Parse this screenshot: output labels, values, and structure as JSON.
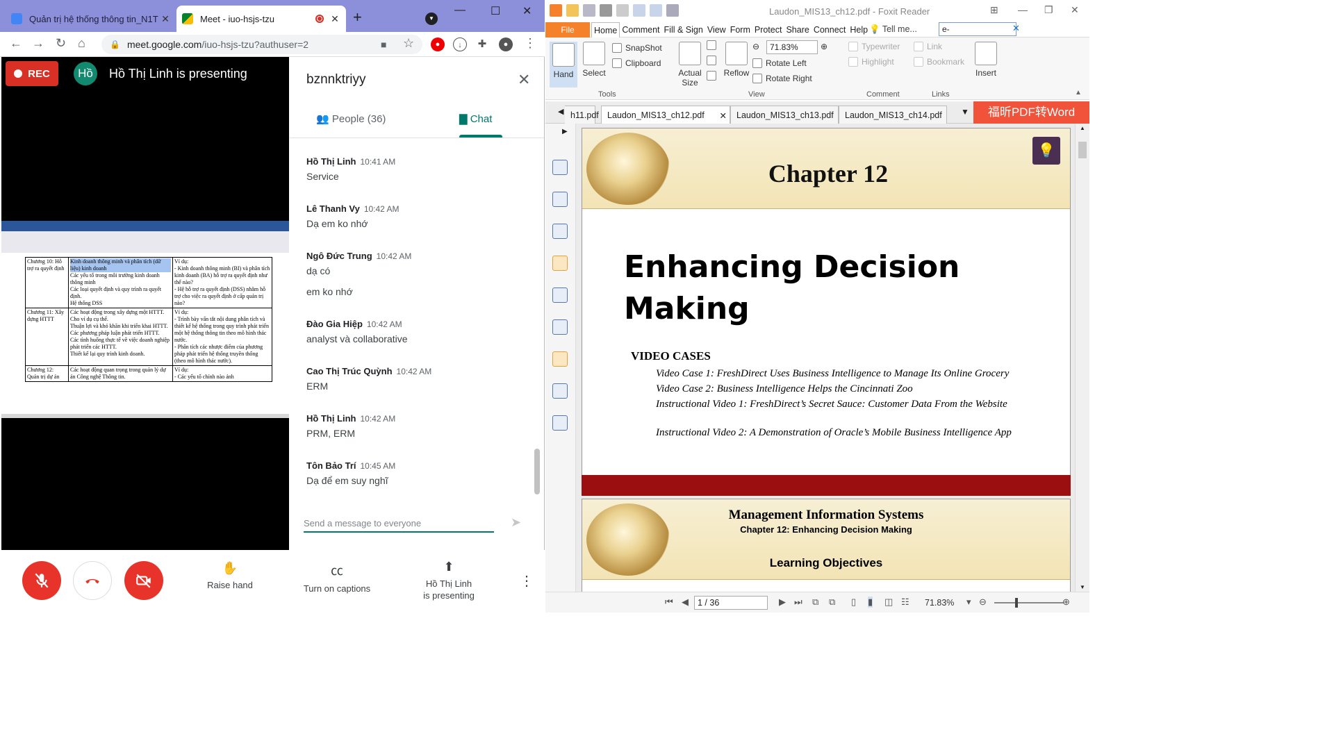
{
  "chrome": {
    "tabs": [
      {
        "title": "Quản trị hệ thống thông tin_N1T",
        "color": "#4285f4",
        "active": false
      },
      {
        "title": "Meet - iuo-hsjs-tzu",
        "color": "#00832d",
        "active": true
      }
    ],
    "url_host": "meet.google.com",
    "url_path": "/iuo-hsjs-tzu?authuser=2"
  },
  "meet": {
    "rec_label": "REC",
    "presenter_initials": "Hồ",
    "presenting_title": "Hồ Thị Linh is presenting",
    "meeting_code": "bznnktriyy",
    "people_tab": "People (36)",
    "chat_tab": "Chat",
    "composer_placeholder": "Send a message to everyone",
    "messages": [
      {
        "sender": "Hồ Thị Linh",
        "time": "10:41 AM",
        "lines": [
          "Service"
        ]
      },
      {
        "sender": "Lê Thanh Vy",
        "time": "10:42 AM",
        "lines": [
          "Dạ em ko nhớ"
        ]
      },
      {
        "sender": "Ngô Đức Trung",
        "time": "10:42 AM",
        "lines": [
          "dạ có",
          "em ko nhớ"
        ]
      },
      {
        "sender": "Đào Gia Hiệp",
        "time": "10:42 AM",
        "lines": [
          "analyst và collaborative"
        ]
      },
      {
        "sender": "Cao Thị Trúc Quỳnh",
        "time": "10:42 AM",
        "lines": [
          "ERM"
        ]
      },
      {
        "sender": "Hồ Thị Linh",
        "time": "10:42 AM",
        "lines": [
          "PRM, ERM"
        ]
      },
      {
        "sender": "Tôn Bảo Trí",
        "time": "10:45 AM",
        "lines": [
          "Dạ để em suy nghĩ"
        ]
      }
    ],
    "controls": {
      "raise_hand": "Raise hand",
      "captions": "Turn on captions",
      "presenting_line1": "Hồ Thị Linh",
      "presenting_line2": "is presenting"
    },
    "shared_doc": {
      "rows": [
        {
          "chapter": "Chương 10: Hỗ trợ ra quyết định",
          "content": [
            "Kinh doanh thông minh và phân tích (dữ liệu) kinh doanh",
            "Các yếu tố trong môi trường kinh doanh thông minh",
            "Các loại quyết định và quy trình ra quyết định.",
            "Hệ thống DSS"
          ],
          "example": [
            "Ví dụ:",
            "- Kinh doanh thông minh (BI) và phân tích kinh doanh (BA) hỗ trợ ra quyết định như thế nào?",
            "- Hệ hỗ trợ ra quyết định (DSS) nhằm hỗ trợ cho việc ra quyết định ở cấp quản trị nào?"
          ]
        },
        {
          "chapter": "Chương 11: Xây dựng HTTT",
          "content": [
            "Các hoạt động trong xây dựng một HTTT. Cho ví dụ cụ thể.",
            "Thuận lợi và khó khăn khi triển khai HTTT.",
            "Các phương pháp luận phát triển HTTT.",
            "Các tình huống thực tế về việc doanh nghiệp phát triển các HTTT.",
            "Thiết kế lại quy trình kinh doanh."
          ],
          "example": [
            "Ví dụ:",
            "- Trình bày vấn tắt nội dung phân tích và thiết kế hệ thống trong quy trình phát triển một hệ thống thông tin theo mô hình thác nước.",
            "- Phân tích các nhược điểm của phương pháp phát triển hệ thống truyền thống (theo mô hình thác nước)."
          ]
        },
        {
          "chapter": "Chương 12: Quản trị dự án",
          "content": [
            "Các hoạt động quan trọng trong quản lý dự án Công nghệ Thông tin."
          ],
          "example": [
            "Ví dụ:",
            "- Các yếu tố chính nào ảnh"
          ]
        }
      ]
    }
  },
  "foxit": {
    "window_title": "Laudon_MIS13_ch12.pdf - Foxit Reader",
    "menu": [
      "File",
      "Home",
      "Comment",
      "Fill & Sign",
      "View",
      "Form",
      "Protect",
      "Share",
      "Connect",
      "Help"
    ],
    "tell_me": "Tell me...",
    "search_value": "e-",
    "ribbon": {
      "hand": "Hand",
      "select": "Select",
      "snapshot": "SnapShot",
      "clipboard": "Clipboard",
      "tools_label": "Tools",
      "actual_size_1": "Actual",
      "actual_size_2": "Size",
      "reflow": "Reflow",
      "zoom": "71.83%",
      "rotate_left": "Rotate Left",
      "rotate_right": "Rotate Right",
      "view_label": "View",
      "typewriter": "Typewriter",
      "highlight": "Highlight",
      "comment_label": "Comment",
      "link": "Link",
      "bookmark": "Bookmark",
      "links_label": "Links",
      "insert": "Insert"
    },
    "doc_tabs": [
      "h11.pdf",
      "Laudon_MIS13_ch12.pdf",
      "Laudon_MIS13_ch13.pdf",
      "Laudon_MIS13_ch14.pdf"
    ],
    "brand": "福昕PDF转Word",
    "page1": {
      "chapter": "Chapter 12",
      "title_line1": "Enhancing Decision",
      "title_line2": "Making",
      "video_heading": "VIDEO CASES",
      "video_cases": [
        "Video Case 1: FreshDirect Uses Business Intelligence to Manage Its Online Grocery",
        "Video Case 2:  Business Intelligence Helps the Cincinnati Zoo",
        "Instructional Video 1:  FreshDirect’s Secret Sauce:  Customer Data From the Website",
        "Instructional Video 2: A Demonstration of Oracle’s Mobile Business Intelligence App"
      ]
    },
    "page2": {
      "title": "Management Information Systems",
      "subtitle": "Chapter 12: Enhancing Decision Making",
      "section": "Learning Objectives"
    },
    "status": {
      "page": "1 / 36",
      "zoom": "71.83%"
    }
  }
}
